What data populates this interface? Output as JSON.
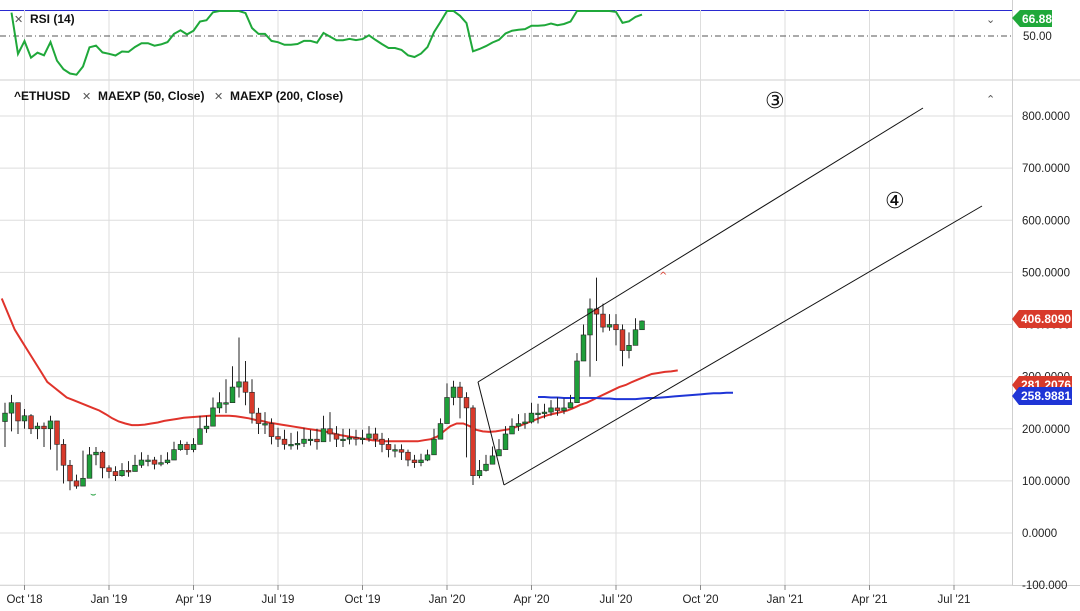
{
  "rsi_panel": {
    "label": "RSI (14)",
    "close_icon": "close-x-icon",
    "collapse_icon": "chevron-down-icon",
    "current_value": "66.88",
    "midline_label": "50.00",
    "upper_value": 70,
    "midline_value": 50
  },
  "price_panel": {
    "symbol": "^ETHUSD",
    "study1": "MAEXP (50, Close)",
    "study2": "MAEXP (200, Close)",
    "close_icon": "close-x-icon",
    "collapse_icon": "chevron-up-icon",
    "last_price": "406.8090",
    "ma50_value": "281.2076",
    "ma200_value": "258.9881",
    "annotation3": "③",
    "annotation4": "④"
  },
  "colors": {
    "up": "#1e9e3a",
    "down": "#d83a2b",
    "rsi": "#1fa83a",
    "ma50": "#e0332b",
    "ma200": "#1f35d6",
    "grid": "#dddddd",
    "guide": "#2a2ad0"
  },
  "chart_data": {
    "type": "candlestick",
    "title": "",
    "ylim": [
      -100,
      900
    ],
    "y_ticks": [
      "800.0000",
      "700.0000",
      "600.0000",
      "500.0000",
      "400.0000",
      "300.0000",
      "200.0000",
      "100.0000",
      "0.0000",
      "-100.000"
    ],
    "x_ticks": [
      "Oct '18",
      "Jan '19",
      "Apr '19",
      "Jul '19",
      "Oct '19",
      "Jan '20",
      "Apr '20",
      "Jul '20",
      "Oct '20",
      "Jan '21",
      "Apr '21",
      "Jul '21"
    ],
    "x_tick_weeks": [
      3,
      16,
      29,
      42,
      55,
      68,
      81,
      94,
      107,
      120,
      133,
      146
    ],
    "weekly_close": [
      230,
      250,
      215,
      225,
      200,
      205,
      200,
      215,
      170,
      130,
      100,
      90,
      105,
      150,
      155,
      125,
      118,
      110,
      120,
      118,
      130,
      140,
      140,
      132,
      135,
      140,
      160,
      170,
      160,
      170,
      200,
      205,
      240,
      250,
      250,
      280,
      290,
      270,
      230,
      210,
      210,
      185,
      180,
      170,
      170,
      172,
      180,
      180,
      175,
      200,
      190,
      180,
      180,
      183,
      180,
      182,
      190,
      180,
      170,
      160,
      160,
      155,
      140,
      135,
      140,
      150,
      180,
      210,
      260,
      280,
      260,
      240,
      110,
      120,
      132,
      148,
      160,
      190,
      205,
      210,
      213,
      230,
      230,
      232,
      240,
      235,
      240,
      250,
      330,
      380,
      430,
      420,
      395,
      400,
      390,
      350,
      360,
      390,
      406.8
    ],
    "weekly_low": [
      165,
      195,
      190,
      200,
      190,
      180,
      165,
      160,
      120,
      95,
      82,
      85,
      95,
      120,
      130,
      105,
      105,
      100,
      108,
      108,
      118,
      125,
      128,
      122,
      128,
      132,
      148,
      158,
      150,
      155,
      185,
      192,
      225,
      230,
      230,
      260,
      260,
      245,
      210,
      190,
      190,
      170,
      165,
      160,
      160,
      160,
      165,
      168,
      160,
      180,
      175,
      165,
      165,
      170,
      168,
      170,
      175,
      165,
      155,
      145,
      145,
      140,
      128,
      125,
      128,
      138,
      165,
      195,
      240,
      245,
      220,
      145,
      92,
      105,
      118,
      135,
      148,
      178,
      192,
      196,
      200,
      210,
      210,
      220,
      225,
      225,
      228,
      240,
      300,
      350,
      300,
      330,
      385,
      388,
      360,
      320,
      335,
      365,
      404
    ],
    "weekly_high": [
      250,
      265,
      248,
      238,
      228,
      212,
      212,
      225,
      215,
      180,
      140,
      112,
      158,
      165,
      165,
      158,
      130,
      128,
      134,
      138,
      150,
      155,
      150,
      146,
      150,
      155,
      175,
      178,
      175,
      182,
      225,
      225,
      260,
      270,
      295,
      320,
      375,
      330,
      295,
      240,
      232,
      220,
      202,
      198,
      192,
      195,
      202,
      198,
      200,
      225,
      232,
      205,
      200,
      200,
      198,
      198,
      205,
      202,
      192,
      182,
      170,
      170,
      160,
      150,
      152,
      160,
      200,
      220,
      287,
      292,
      290,
      270,
      245,
      140,
      150,
      166,
      180,
      205,
      220,
      228,
      230,
      250,
      248,
      248,
      255,
      260,
      258,
      265,
      345,
      400,
      450,
      490,
      440,
      420,
      420,
      400,
      385,
      412,
      408
    ],
    "ma50": [
      450,
      420,
      390,
      370,
      350,
      330,
      310,
      290,
      280,
      270,
      260,
      255,
      250,
      245,
      240,
      235,
      228,
      220,
      214,
      210,
      207,
      207,
      208,
      210,
      212,
      215,
      217,
      219,
      221,
      222,
      223,
      224,
      225,
      225,
      225,
      225,
      224,
      222,
      220,
      217,
      215,
      212,
      210,
      208,
      206,
      204,
      202,
      200,
      198,
      196,
      194,
      191,
      188,
      186,
      184,
      182,
      180,
      178,
      177,
      176,
      176,
      176,
      176,
      176,
      176,
      178,
      180,
      185,
      195,
      205,
      210,
      210,
      205,
      198,
      195,
      194,
      195,
      197,
      199,
      203,
      207,
      212,
      217,
      222,
      226,
      229,
      232,
      235,
      240,
      246,
      250,
      256,
      262,
      268,
      274,
      280,
      284,
      290,
      295,
      300,
      305,
      307,
      309,
      310,
      312
    ],
    "ma200_start_week": 82,
    "ma200": [
      261,
      261,
      260,
      260,
      259,
      259,
      259,
      259,
      259,
      259,
      258,
      258,
      257,
      257,
      257,
      257,
      258,
      259,
      259,
      260,
      261,
      262,
      263,
      264,
      265,
      266,
      267,
      268,
      268,
      269,
      269
    ]
  }
}
